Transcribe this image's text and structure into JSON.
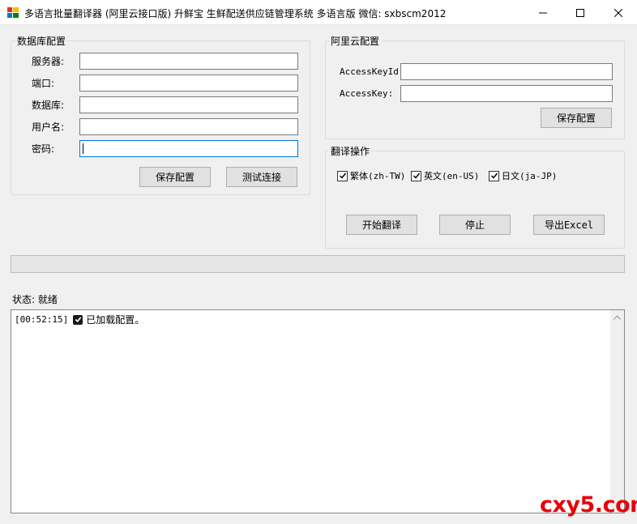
{
  "window": {
    "title": "多语言批量翻译器 (阿里云接口版) 升鲜宝 生鲜配送供应链管理系统  多语言版  微信: sxbscm2012",
    "minimize_label": "—",
    "maximize_label": "☐",
    "close_label": "✕"
  },
  "db_config": {
    "title": "数据库配置",
    "server_label": "服务器:",
    "server_value": "",
    "port_label": "端口:",
    "port_value": "",
    "database_label": "数据库:",
    "database_value": "",
    "username_label": "用户名:",
    "username_value": "",
    "password_label": "密码:",
    "password_value": "",
    "save_label": "保存配置",
    "test_label": "测试连接"
  },
  "aliyun_config": {
    "title": "阿里云配置",
    "key_id_label": "AccessKeyId:",
    "key_id_value": "",
    "key_label": "AccessKey:",
    "key_value": "",
    "save_label": "保存配置"
  },
  "translate": {
    "title": "翻译操作",
    "languages": [
      {
        "label": "繁体(zh-TW)",
        "checked": true
      },
      {
        "label": "英文(en-US)",
        "checked": true
      },
      {
        "label": "日文(ja-JP)",
        "checked": true
      }
    ],
    "start_label": "开始翻译",
    "stop_label": "停止",
    "export_label": "导出Excel"
  },
  "progress": {
    "value": 0
  },
  "status": {
    "label": "状态:",
    "value": "就绪"
  },
  "log": {
    "entries": [
      {
        "time": "[00:52:15]",
        "icon": "check-box-icon",
        "message": "已加载配置。"
      }
    ]
  },
  "watermark": {
    "text": "cxy5.com"
  },
  "colors": {
    "accent": "#0078d7",
    "watermark": "#e8000c",
    "button_face": "#e1e1e1"
  }
}
